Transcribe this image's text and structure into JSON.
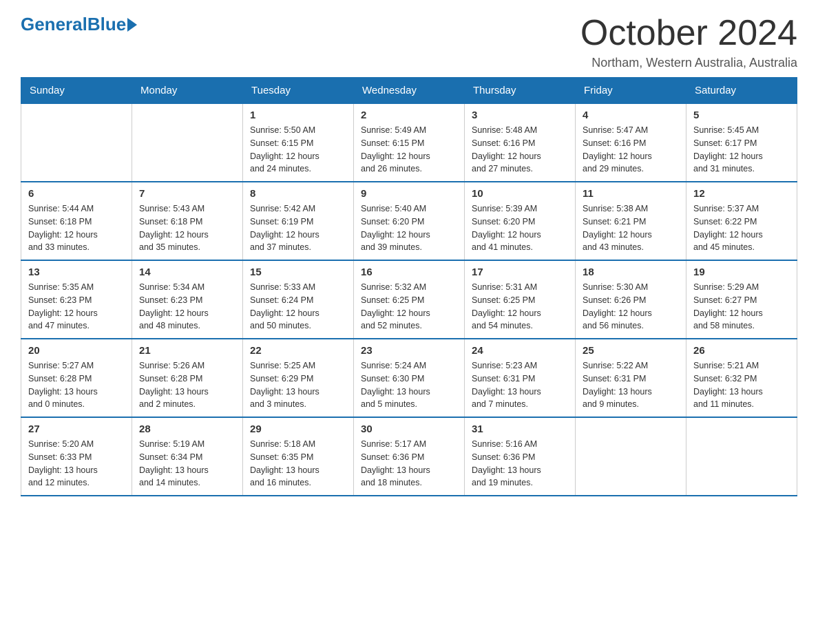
{
  "header": {
    "logo_general": "General",
    "logo_blue": "Blue",
    "month_title": "October 2024",
    "location": "Northam, Western Australia, Australia"
  },
  "weekdays": [
    "Sunday",
    "Monday",
    "Tuesday",
    "Wednesday",
    "Thursday",
    "Friday",
    "Saturday"
  ],
  "weeks": [
    [
      {
        "day": "",
        "info": ""
      },
      {
        "day": "",
        "info": ""
      },
      {
        "day": "1",
        "info": "Sunrise: 5:50 AM\nSunset: 6:15 PM\nDaylight: 12 hours\nand 24 minutes."
      },
      {
        "day": "2",
        "info": "Sunrise: 5:49 AM\nSunset: 6:15 PM\nDaylight: 12 hours\nand 26 minutes."
      },
      {
        "day": "3",
        "info": "Sunrise: 5:48 AM\nSunset: 6:16 PM\nDaylight: 12 hours\nand 27 minutes."
      },
      {
        "day": "4",
        "info": "Sunrise: 5:47 AM\nSunset: 6:16 PM\nDaylight: 12 hours\nand 29 minutes."
      },
      {
        "day": "5",
        "info": "Sunrise: 5:45 AM\nSunset: 6:17 PM\nDaylight: 12 hours\nand 31 minutes."
      }
    ],
    [
      {
        "day": "6",
        "info": "Sunrise: 5:44 AM\nSunset: 6:18 PM\nDaylight: 12 hours\nand 33 minutes."
      },
      {
        "day": "7",
        "info": "Sunrise: 5:43 AM\nSunset: 6:18 PM\nDaylight: 12 hours\nand 35 minutes."
      },
      {
        "day": "8",
        "info": "Sunrise: 5:42 AM\nSunset: 6:19 PM\nDaylight: 12 hours\nand 37 minutes."
      },
      {
        "day": "9",
        "info": "Sunrise: 5:40 AM\nSunset: 6:20 PM\nDaylight: 12 hours\nand 39 minutes."
      },
      {
        "day": "10",
        "info": "Sunrise: 5:39 AM\nSunset: 6:20 PM\nDaylight: 12 hours\nand 41 minutes."
      },
      {
        "day": "11",
        "info": "Sunrise: 5:38 AM\nSunset: 6:21 PM\nDaylight: 12 hours\nand 43 minutes."
      },
      {
        "day": "12",
        "info": "Sunrise: 5:37 AM\nSunset: 6:22 PM\nDaylight: 12 hours\nand 45 minutes."
      }
    ],
    [
      {
        "day": "13",
        "info": "Sunrise: 5:35 AM\nSunset: 6:23 PM\nDaylight: 12 hours\nand 47 minutes."
      },
      {
        "day": "14",
        "info": "Sunrise: 5:34 AM\nSunset: 6:23 PM\nDaylight: 12 hours\nand 48 minutes."
      },
      {
        "day": "15",
        "info": "Sunrise: 5:33 AM\nSunset: 6:24 PM\nDaylight: 12 hours\nand 50 minutes."
      },
      {
        "day": "16",
        "info": "Sunrise: 5:32 AM\nSunset: 6:25 PM\nDaylight: 12 hours\nand 52 minutes."
      },
      {
        "day": "17",
        "info": "Sunrise: 5:31 AM\nSunset: 6:25 PM\nDaylight: 12 hours\nand 54 minutes."
      },
      {
        "day": "18",
        "info": "Sunrise: 5:30 AM\nSunset: 6:26 PM\nDaylight: 12 hours\nand 56 minutes."
      },
      {
        "day": "19",
        "info": "Sunrise: 5:29 AM\nSunset: 6:27 PM\nDaylight: 12 hours\nand 58 minutes."
      }
    ],
    [
      {
        "day": "20",
        "info": "Sunrise: 5:27 AM\nSunset: 6:28 PM\nDaylight: 13 hours\nand 0 minutes."
      },
      {
        "day": "21",
        "info": "Sunrise: 5:26 AM\nSunset: 6:28 PM\nDaylight: 13 hours\nand 2 minutes."
      },
      {
        "day": "22",
        "info": "Sunrise: 5:25 AM\nSunset: 6:29 PM\nDaylight: 13 hours\nand 3 minutes."
      },
      {
        "day": "23",
        "info": "Sunrise: 5:24 AM\nSunset: 6:30 PM\nDaylight: 13 hours\nand 5 minutes."
      },
      {
        "day": "24",
        "info": "Sunrise: 5:23 AM\nSunset: 6:31 PM\nDaylight: 13 hours\nand 7 minutes."
      },
      {
        "day": "25",
        "info": "Sunrise: 5:22 AM\nSunset: 6:31 PM\nDaylight: 13 hours\nand 9 minutes."
      },
      {
        "day": "26",
        "info": "Sunrise: 5:21 AM\nSunset: 6:32 PM\nDaylight: 13 hours\nand 11 minutes."
      }
    ],
    [
      {
        "day": "27",
        "info": "Sunrise: 5:20 AM\nSunset: 6:33 PM\nDaylight: 13 hours\nand 12 minutes."
      },
      {
        "day": "28",
        "info": "Sunrise: 5:19 AM\nSunset: 6:34 PM\nDaylight: 13 hours\nand 14 minutes."
      },
      {
        "day": "29",
        "info": "Sunrise: 5:18 AM\nSunset: 6:35 PM\nDaylight: 13 hours\nand 16 minutes."
      },
      {
        "day": "30",
        "info": "Sunrise: 5:17 AM\nSunset: 6:36 PM\nDaylight: 13 hours\nand 18 minutes."
      },
      {
        "day": "31",
        "info": "Sunrise: 5:16 AM\nSunset: 6:36 PM\nDaylight: 13 hours\nand 19 minutes."
      },
      {
        "day": "",
        "info": ""
      },
      {
        "day": "",
        "info": ""
      }
    ]
  ]
}
